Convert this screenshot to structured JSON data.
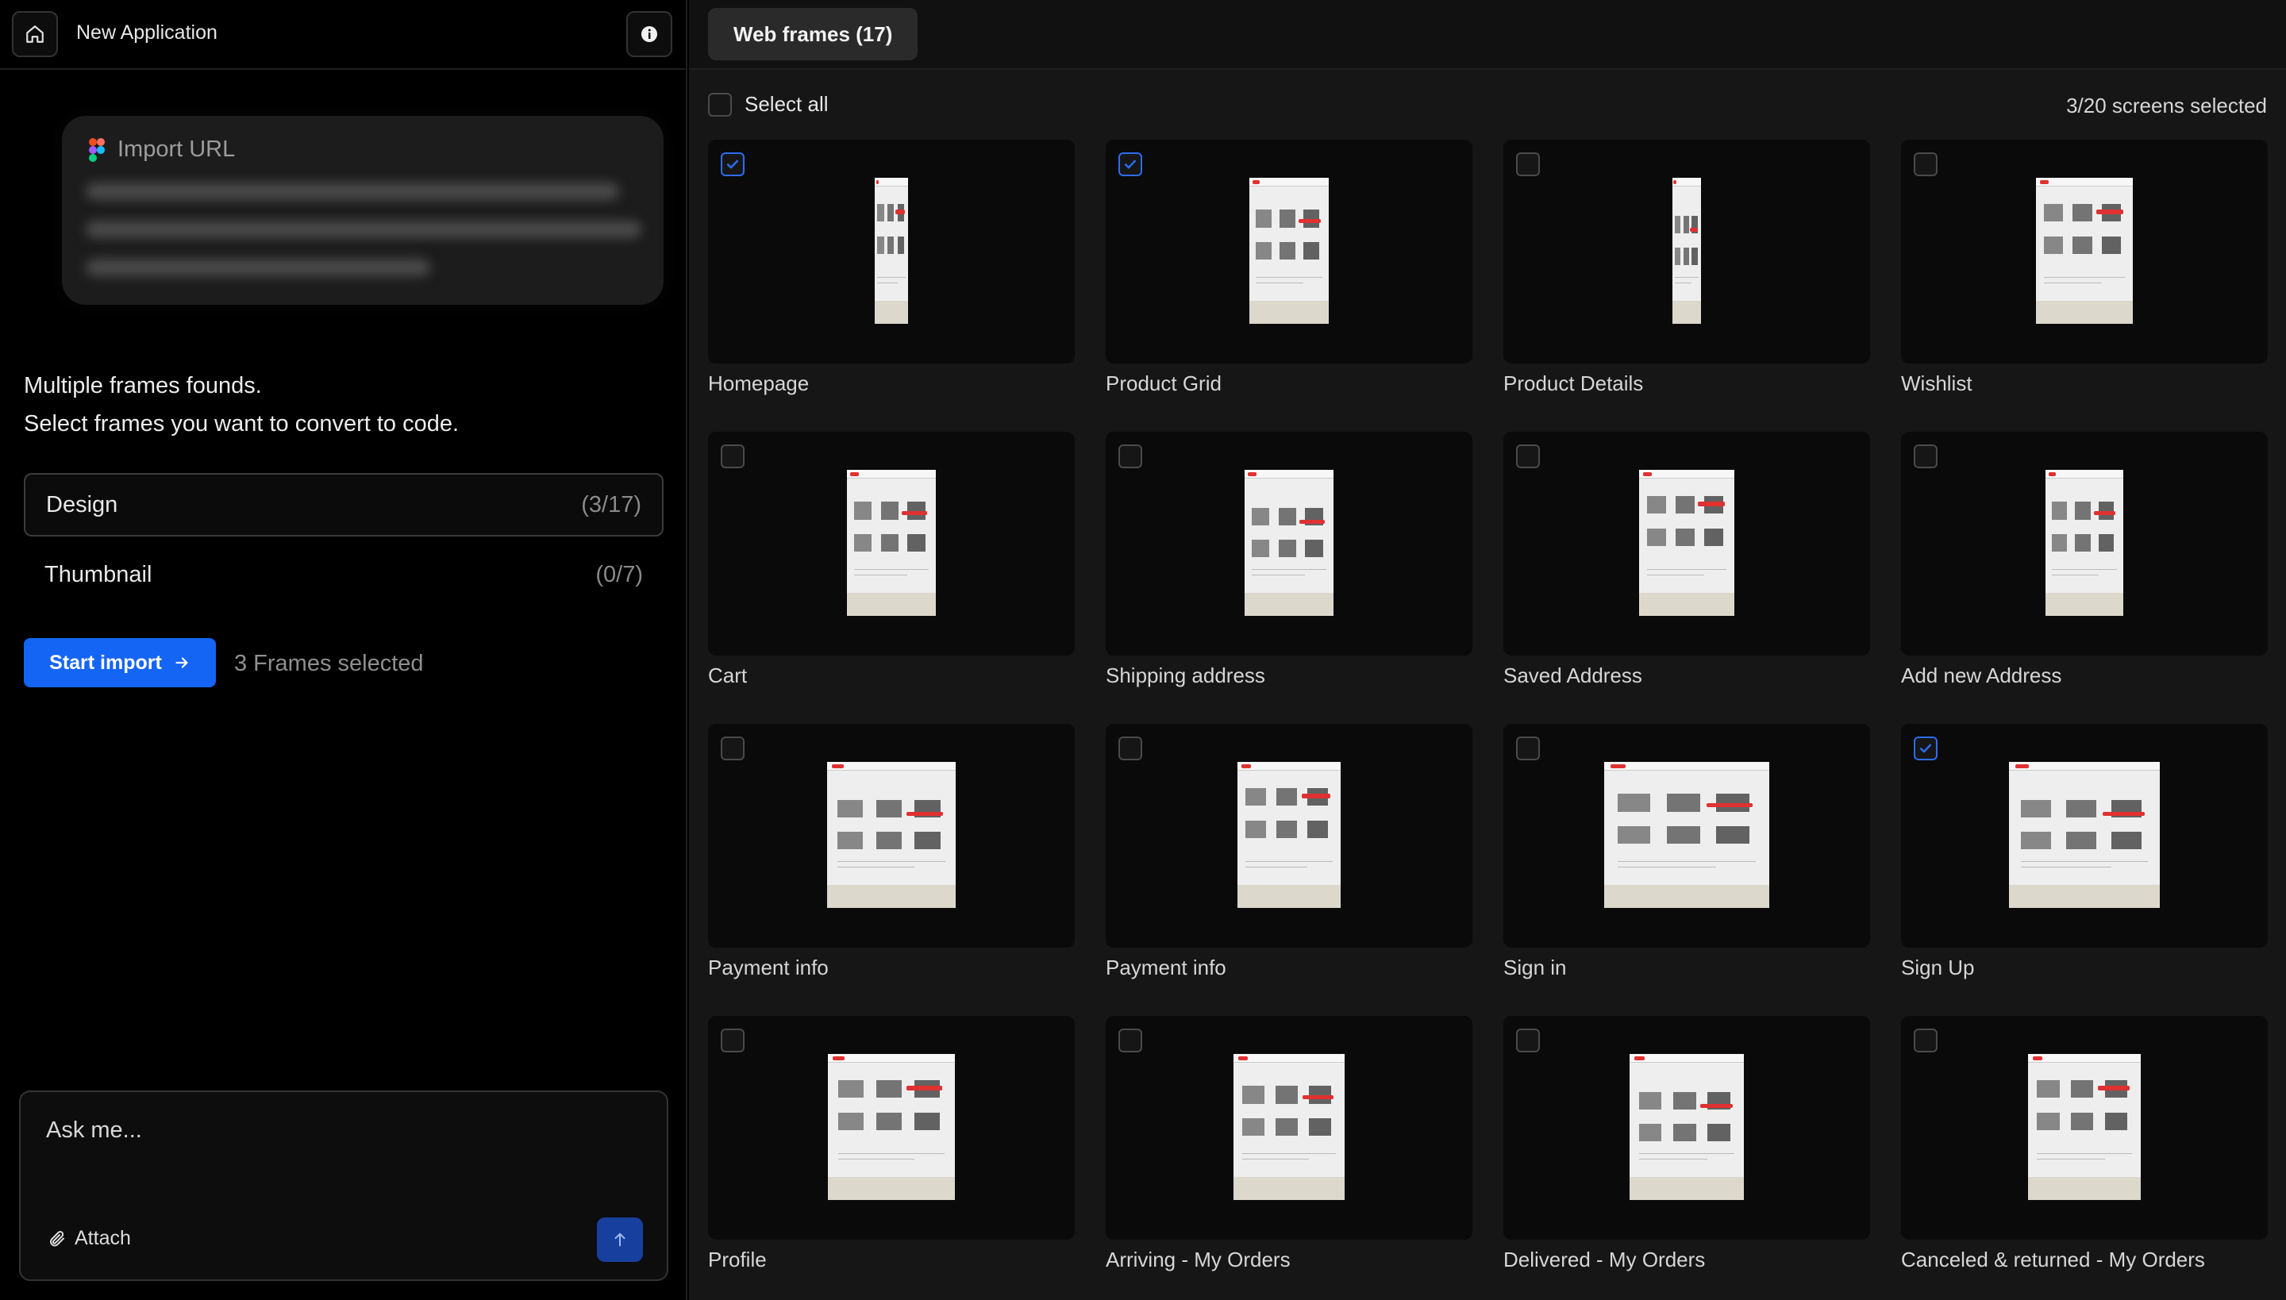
{
  "app": {
    "title": "New Application"
  },
  "import": {
    "label": "Import URL"
  },
  "messages": {
    "line1": "Multiple frames founds.",
    "line2": "Select frames you want to convert to code."
  },
  "options": [
    {
      "label": "Design",
      "count": "(3/17)",
      "active": true
    },
    {
      "label": "Thumbnail",
      "count": "(0/7)",
      "active": false
    }
  ],
  "start_button": {
    "label": "Start import"
  },
  "frames_selected": "3 Frames selected",
  "chat": {
    "placeholder": "Ask me...",
    "attach_label": "Attach"
  },
  "tabs": {
    "web_frames": "Web frames (17)"
  },
  "selection": {
    "select_all_label": "Select all",
    "screens_selected": "3/20 screens selected"
  },
  "colors": {
    "accent": "#1565f5",
    "check": "#2d6cf0"
  },
  "frames": [
    {
      "label": "Homepage",
      "checked": true
    },
    {
      "label": "Product Grid",
      "checked": true
    },
    {
      "label": "Product Details",
      "checked": false
    },
    {
      "label": "Wishlist",
      "checked": false
    },
    {
      "label": "Cart",
      "checked": false
    },
    {
      "label": "Shipping address",
      "checked": false
    },
    {
      "label": "Saved Address",
      "checked": false
    },
    {
      "label": "Add new Address",
      "checked": false
    },
    {
      "label": "Payment info",
      "checked": false
    },
    {
      "label": "Payment info",
      "checked": false
    },
    {
      "label": "Sign in",
      "checked": false
    },
    {
      "label": "Sign Up",
      "checked": true
    },
    {
      "label": "Profile",
      "checked": false
    },
    {
      "label": "Arriving - My Orders",
      "checked": false
    },
    {
      "label": "Delivered - My Orders",
      "checked": false
    },
    {
      "label": "Canceled & returned - My Orders",
      "checked": false
    }
  ]
}
